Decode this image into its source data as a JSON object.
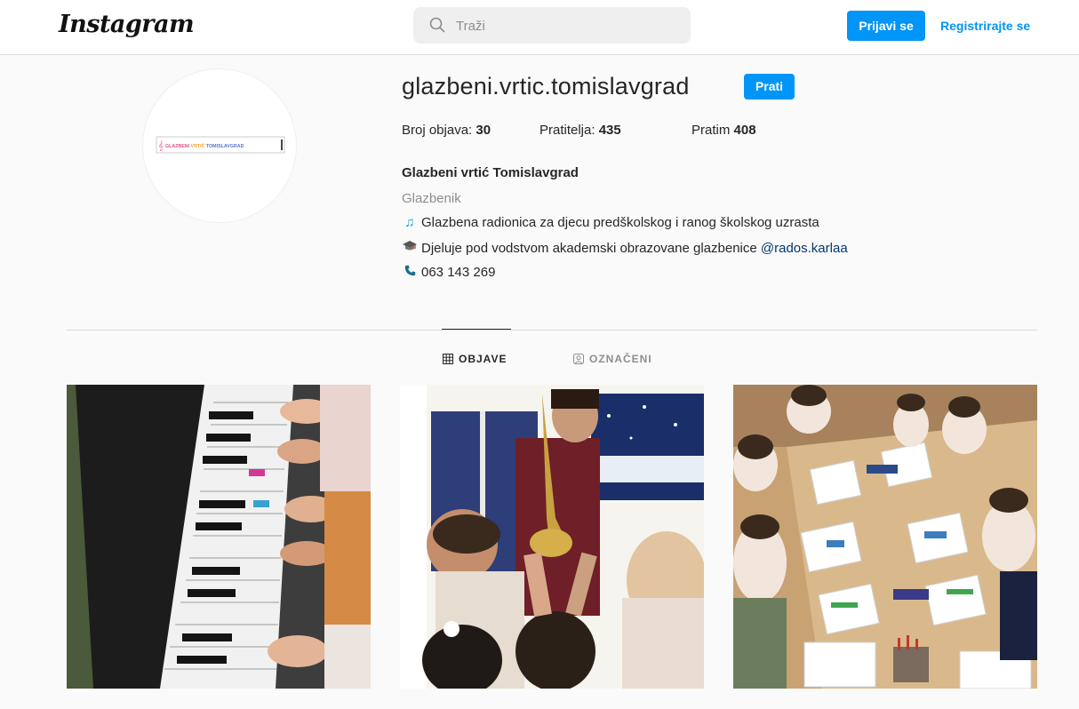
{
  "header": {
    "logo_text": "Instagram",
    "search_placeholder": "Traži",
    "login_label": "Prijavi se",
    "register_label": "Registrirajte se"
  },
  "profile": {
    "username": "glazbeni.vrtic.tomislavgrad",
    "follow_label": "Prati",
    "avatar_text": "GLAZBENI VRTIĆ TOMISLAVGRAD",
    "stats": {
      "posts_label": "Broj objava:",
      "posts_value": "30",
      "followers_label": "Pratitelja:",
      "followers_value": "435",
      "following_label": "Pratim",
      "following_value": "408"
    },
    "full_name": "Glazbeni vrtić Tomislavgrad",
    "category": "Glazbenik",
    "bio_line1": "Glazbena radionica za djecu predškolskog i ranog školskog uzrasta",
    "bio_line2": "Djeluje pod vodstvom akademski obrazovane glazbenice",
    "bio_mention": "@rados.karlaa",
    "phone": "063 143 269"
  },
  "tabs": [
    {
      "label": "OBJAVE",
      "icon": "grid-icon",
      "active": true
    },
    {
      "label": "OZNAČENI",
      "icon": "tagged-icon",
      "active": false
    }
  ],
  "posts": [
    {
      "icon": "photo-piano"
    },
    {
      "icon": "photo-saxophone"
    },
    {
      "icon": "photo-painting"
    }
  ],
  "colors": {
    "accent": "#0095f6",
    "text": "#262626",
    "muted": "#8e8e8e",
    "background": "#fafafa"
  }
}
